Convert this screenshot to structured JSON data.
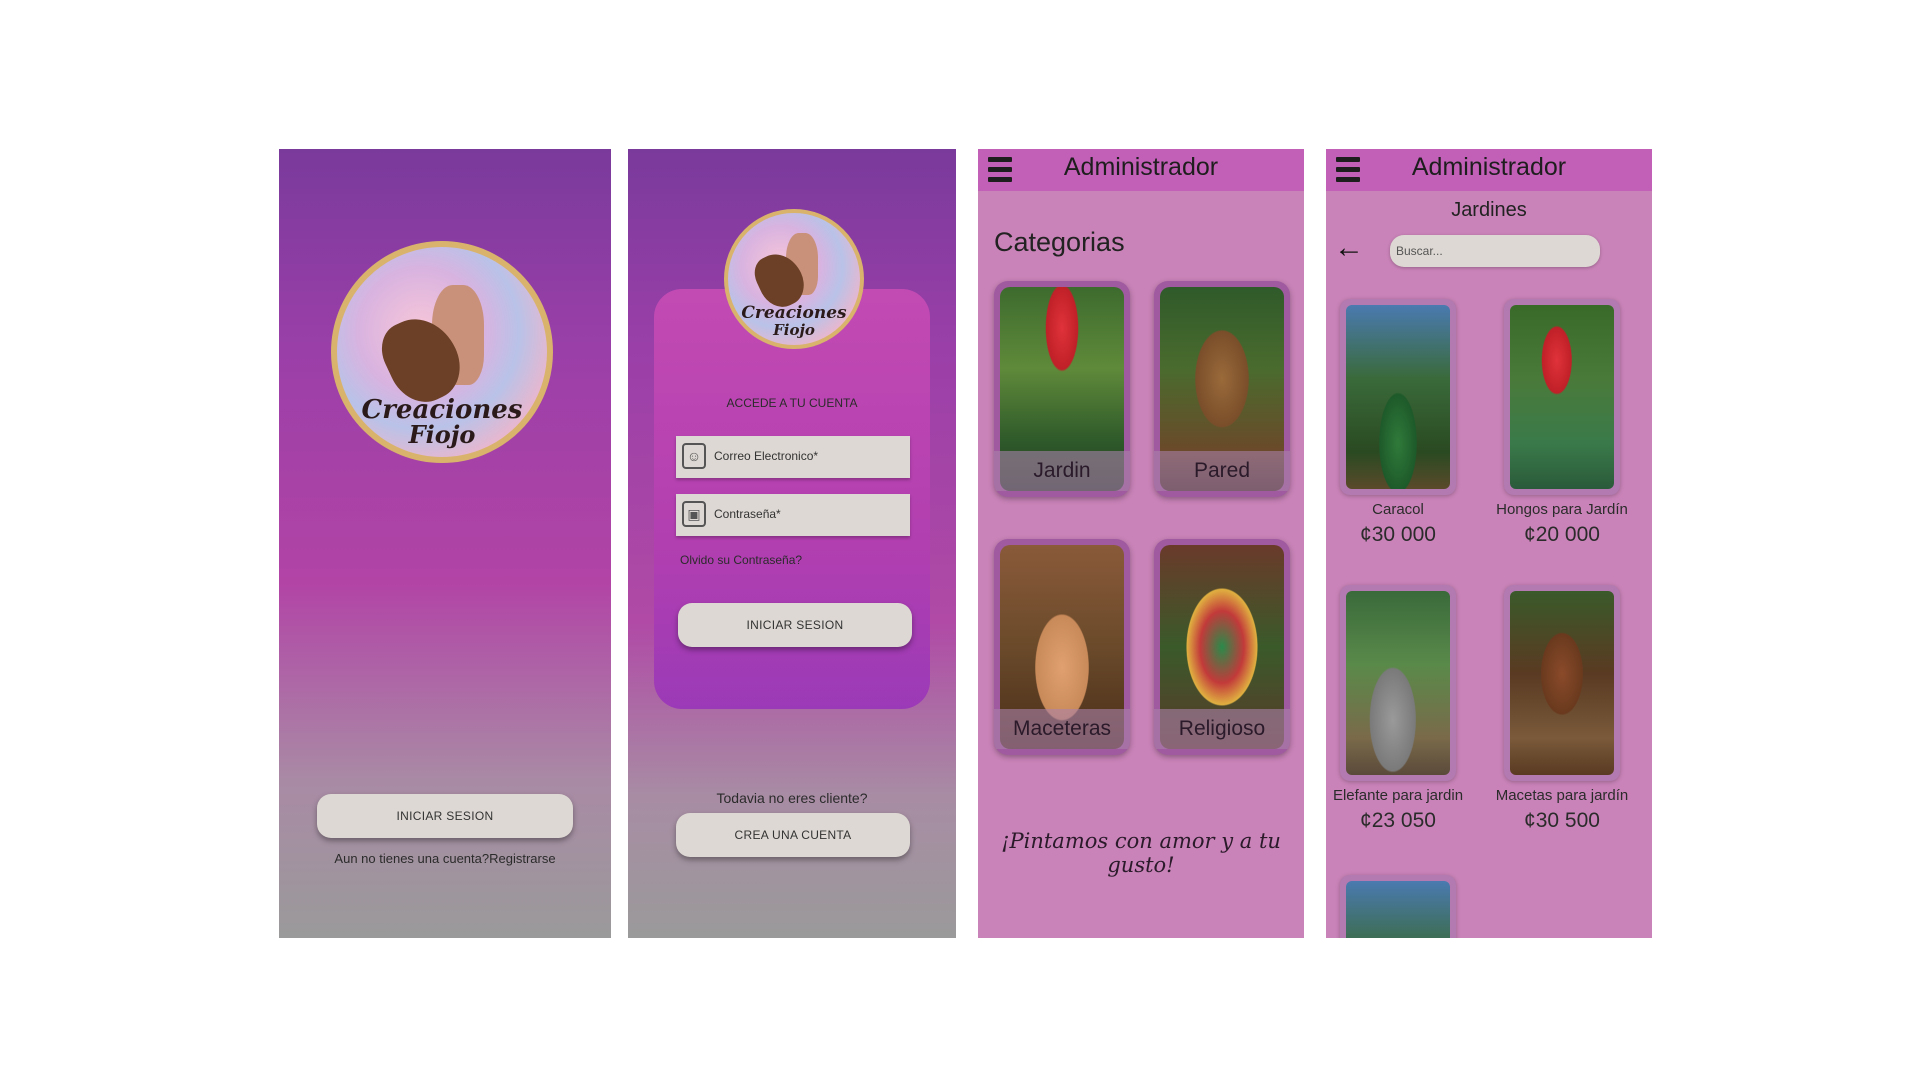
{
  "screen1": {
    "logo_text_line1": "Creaciones",
    "logo_text_line2": "Fiojo",
    "login_button": "INICIAR SESION",
    "register_prompt": "Aun no tienes una cuenta?Registrarse"
  },
  "screen2": {
    "logo_text_line1": "Creaciones",
    "logo_text_line2": "Fiojo",
    "heading": "ACCEDE A TU CUENTA",
    "email_placeholder": "Correo Electronico*",
    "password_placeholder": "Contraseña*",
    "forgot_password": "Olvido su Contraseña?",
    "login_button": "INICIAR SESION",
    "no_account_prompt": "Todavia no eres cliente?",
    "create_account_button": "CREA UNA CUENTA"
  },
  "screen3": {
    "title": "Administrador",
    "section_title": "Categorias",
    "categories": [
      {
        "label": "Jardin",
        "icon": "mushroom-planter-photo"
      },
      {
        "label": "Pared",
        "icon": "owl-photo"
      },
      {
        "label": "Maceteras",
        "icon": "flowerpot-face-photo"
      },
      {
        "label": "Religioso",
        "icon": "virgin-figure-photo"
      }
    ],
    "slogan": "¡Pintamos con amor y a tu gusto!"
  },
  "screen4": {
    "title": "Administrador",
    "subtitle": "Jardines",
    "search_placeholder": "Buscar...",
    "products": [
      {
        "name": "Caracol",
        "price": "¢30 000"
      },
      {
        "name": "Hongos para Jardín",
        "price": "¢20 000"
      },
      {
        "name": "Elefante para jardin",
        "price": "¢23 050"
      },
      {
        "name": "Macetas para jardín",
        "price": "¢30 500"
      }
    ]
  },
  "colors": {
    "accent_purple": "#7a3a9c",
    "accent_magenta": "#b244a6",
    "admin_bar": "#c25fb6",
    "admin_bg": "#c983b8",
    "button_bg": "#ddd8d3"
  }
}
